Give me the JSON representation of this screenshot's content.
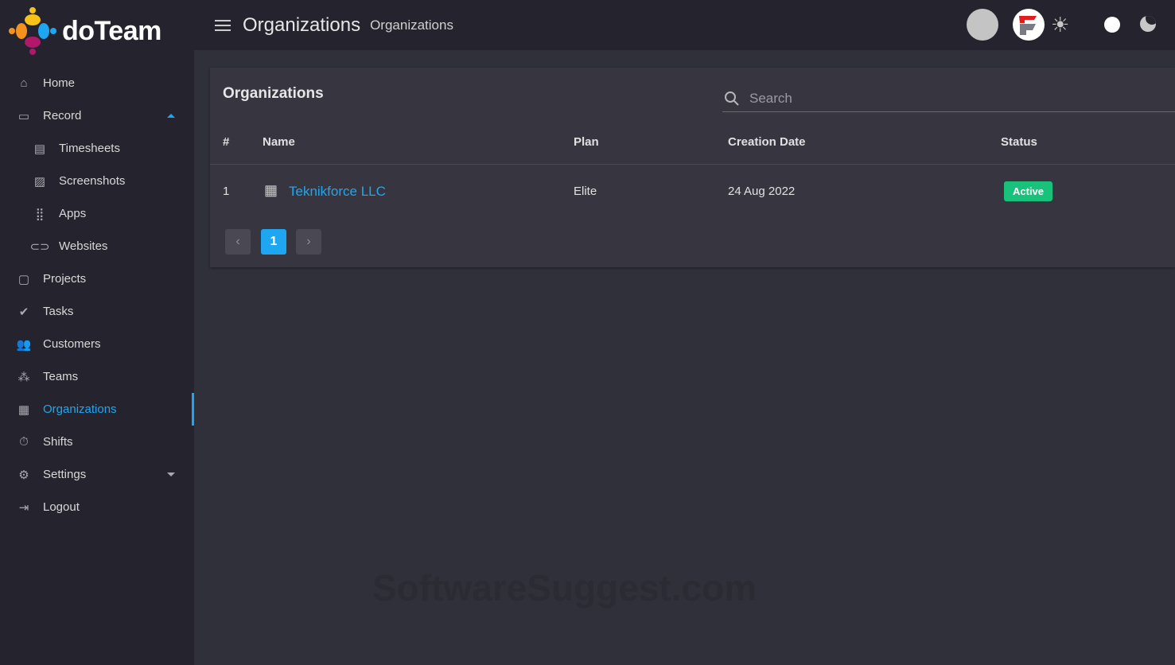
{
  "app": {
    "name": "doTeam"
  },
  "sidebar": {
    "items": [
      {
        "label": "Home",
        "icon": "home-icon"
      },
      {
        "label": "Record",
        "icon": "monitor-icon"
      },
      {
        "label": "Timesheets",
        "icon": "timesheet-icon"
      },
      {
        "label": "Screenshots",
        "icon": "image-icon"
      },
      {
        "label": "Apps",
        "icon": "grid-icon"
      },
      {
        "label": "Websites",
        "icon": "link-icon"
      },
      {
        "label": "Projects",
        "icon": "briefcase-icon"
      },
      {
        "label": "Tasks",
        "icon": "task-icon"
      },
      {
        "label": "Customers",
        "icon": "people-icon"
      },
      {
        "label": "Teams",
        "icon": "teams-icon"
      },
      {
        "label": "Organizations",
        "icon": "building-icon"
      },
      {
        "label": "Shifts",
        "icon": "stopwatch-icon"
      },
      {
        "label": "Settings",
        "icon": "gear-icon"
      },
      {
        "label": "Logout",
        "icon": "logout-icon"
      }
    ]
  },
  "header": {
    "title": "Organizations",
    "subtitle": "Organizations"
  },
  "card": {
    "title": "Organizations",
    "search_placeholder": "Search",
    "columns": [
      "#",
      "Name",
      "Plan",
      "Creation Date",
      "Status"
    ],
    "rows": [
      {
        "num": "1",
        "name": "Teknikforce LLC",
        "plan": "Elite",
        "date": "24 Aug 2022",
        "status": "Active"
      }
    ],
    "pagination": {
      "current": "1",
      "prev": "‹",
      "next": "›"
    }
  },
  "watermark": "SoftwareSuggest.com",
  "colors": {
    "accent": "#1ea7f0",
    "active_badge": "#19c27a"
  }
}
